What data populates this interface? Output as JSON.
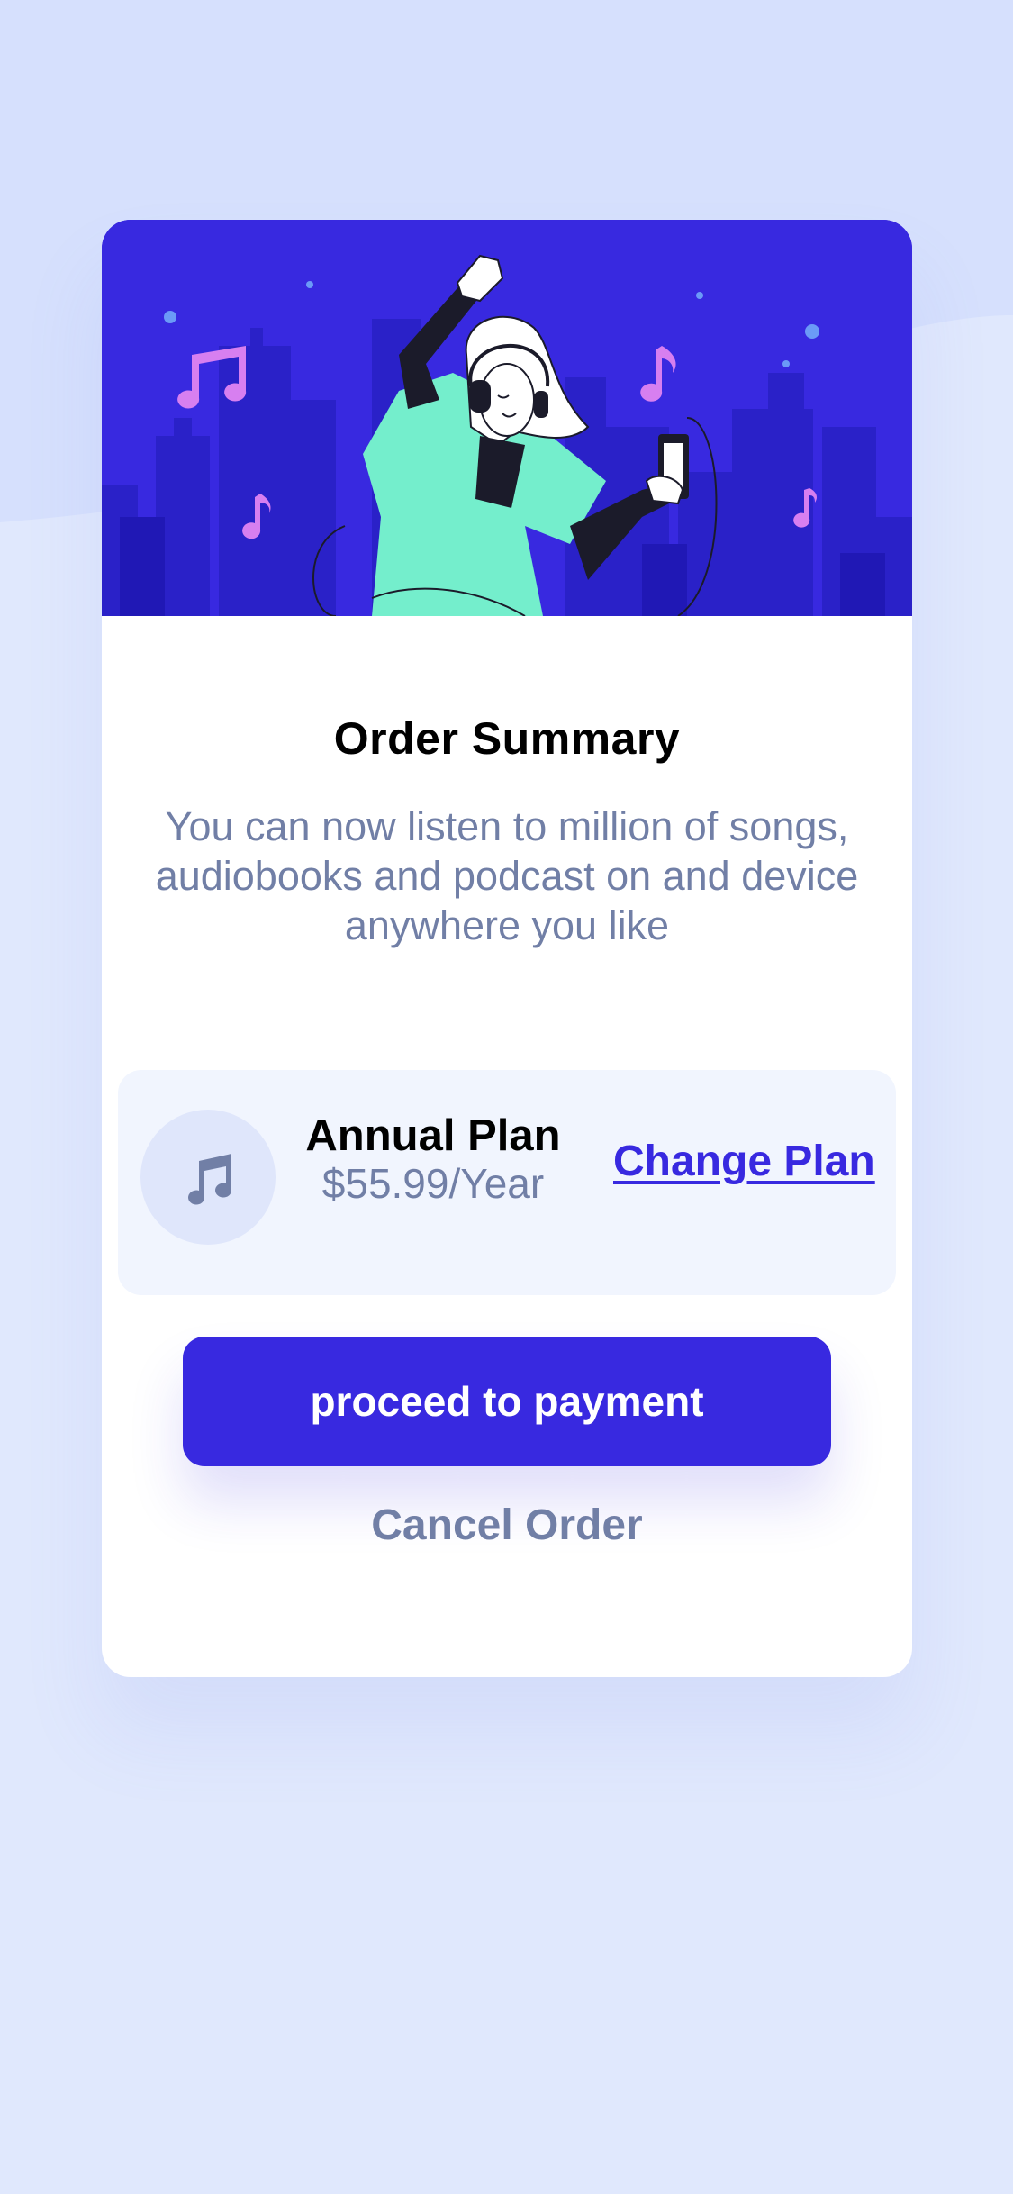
{
  "colors": {
    "page_background": "#e0e8fd",
    "accent": "#3829e0",
    "muted_text": "#717fa6",
    "plan_background": "#f1f5fe"
  },
  "hero": {
    "illustration": "woman-dancing-with-headphones-illustration"
  },
  "summary": {
    "title": "Order Summary",
    "description": "You can now listen to million of songs, audiobooks and podcast on and device anywhere you like"
  },
  "plan": {
    "icon": "music-note-icon",
    "name": "Annual Plan",
    "price": "$55.99/Year",
    "change_label": "Change Plan"
  },
  "actions": {
    "proceed_label": "proceed to payment",
    "cancel_label": "Cancel Order"
  }
}
